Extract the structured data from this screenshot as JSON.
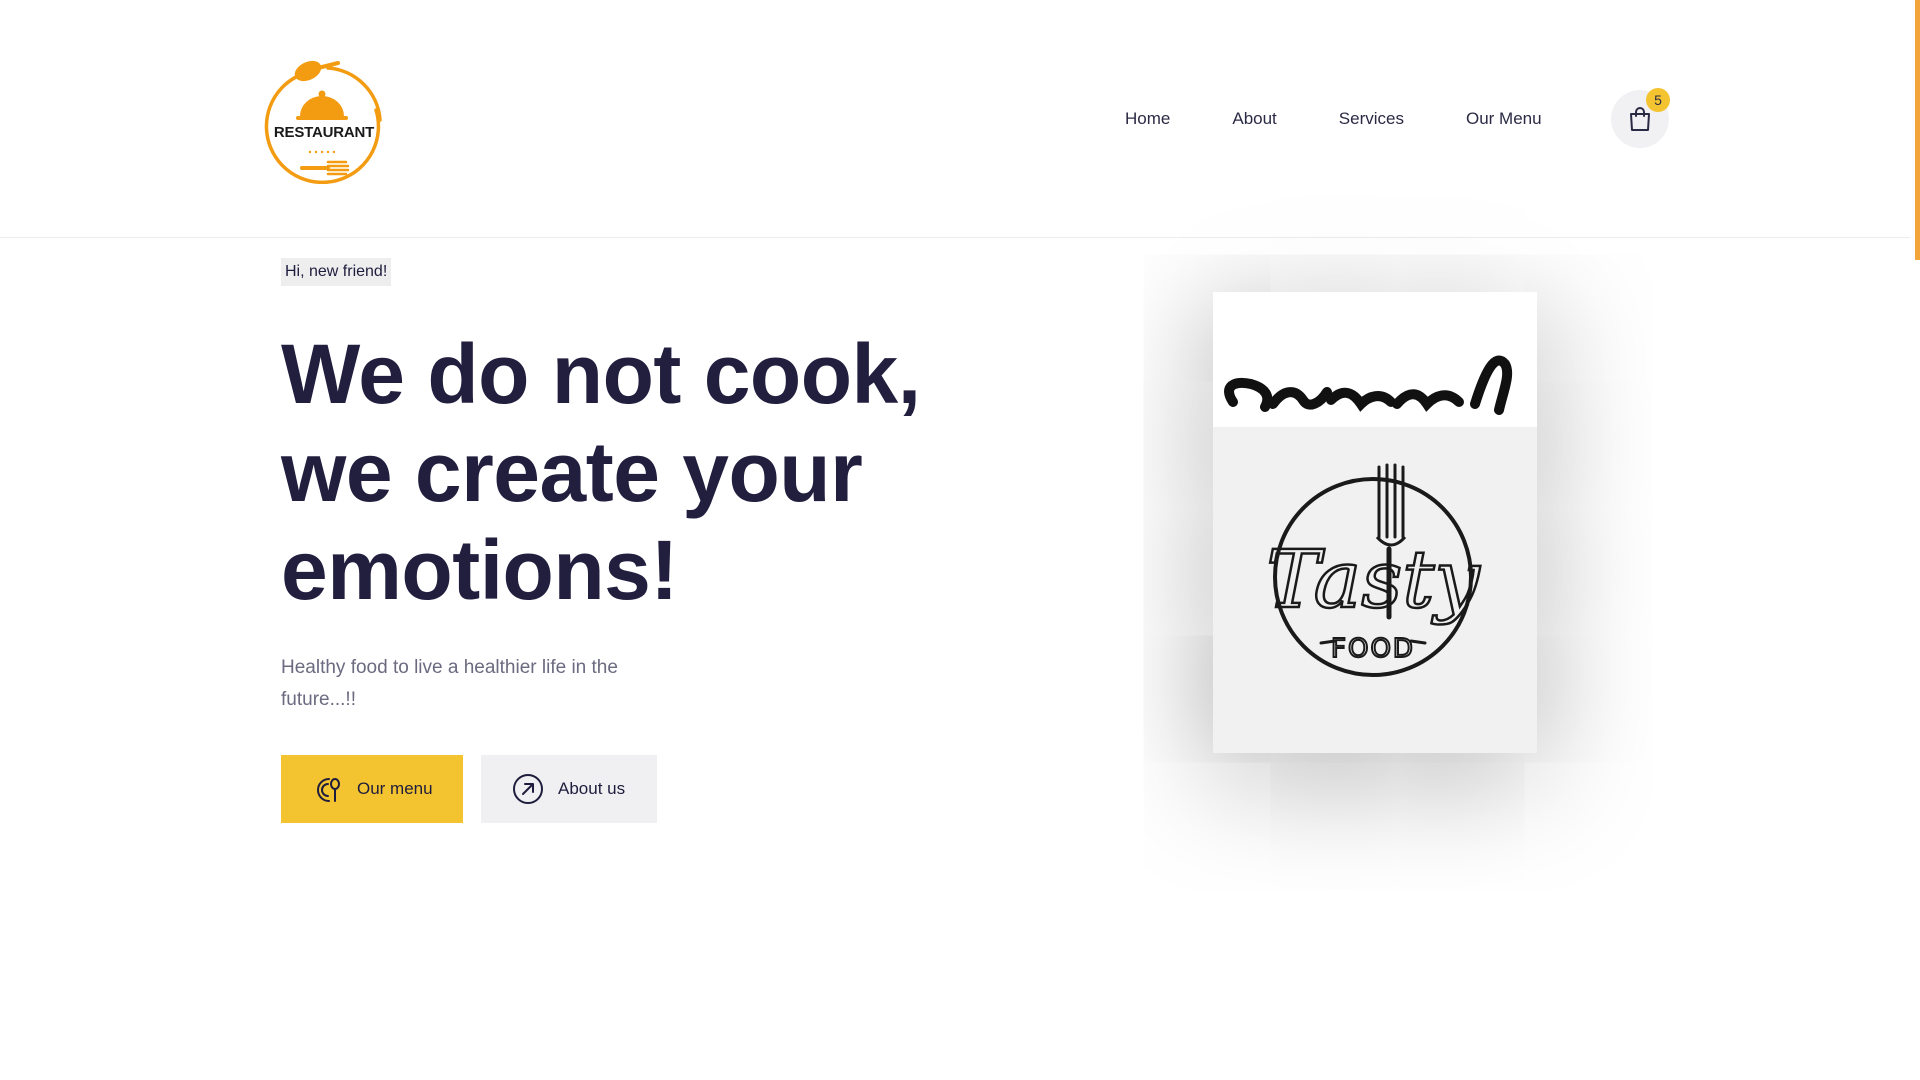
{
  "brand": {
    "logo_text": "RESTAURANT",
    "accent_color": "#f39c12",
    "logo_icon": "cloche-spoon-fork-icon"
  },
  "nav": {
    "items": [
      {
        "label": "Home"
      },
      {
        "label": "About"
      },
      {
        "label": "Services"
      },
      {
        "label": "Our Menu"
      }
    ]
  },
  "cart": {
    "icon": "shopping-bag-icon",
    "count": "5",
    "badge_color": "#f4c430"
  },
  "hero": {
    "greeting": "Hi, new friend!",
    "headline": "We do not cook, we create your emotions!",
    "subtitle": "Healthy food to live a healthier life in the future...!!",
    "buttons": {
      "menu_label": "Our menu",
      "menu_icon": "food-spoon-icon",
      "about_label": "About us",
      "about_icon": "arrow-up-right-circle-icon"
    },
    "image": {
      "top_logo": "yummy-script-logo",
      "main_logo_script": "Tasty",
      "main_logo_caption": "FOOD"
    }
  },
  "colors": {
    "primary_text": "#211e3e",
    "button_yellow": "#f4c430",
    "button_grey": "#f0f0f2",
    "scrollbar": "#f4a53a"
  }
}
